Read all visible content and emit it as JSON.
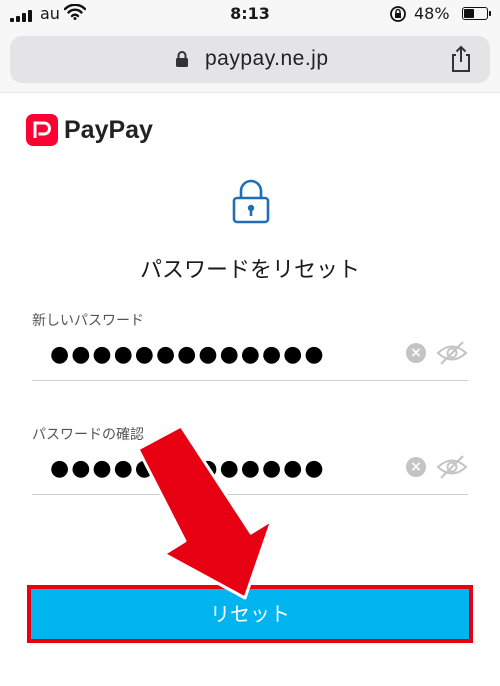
{
  "status_bar": {
    "carrier": "au",
    "time": "8:13",
    "battery_percent": "48%"
  },
  "browser": {
    "url": "paypay.ne.jp"
  },
  "brand": {
    "name": "PayPay",
    "color": "#ff0033"
  },
  "page": {
    "title": "パスワードをリセット"
  },
  "form": {
    "new_password": {
      "label": "新しいパスワード",
      "masked_value": "●●●●●●●●●●●●●"
    },
    "confirm_password": {
      "label": "パスワードの確認",
      "masked_value": "●●●●●●●●●●●●●"
    },
    "submit_label": "リセット"
  },
  "colors": {
    "button": "#00b4ef",
    "highlight": "#e60012",
    "icon_blue": "#1f6fb2"
  },
  "icons": [
    "signal-icon",
    "wifi-icon",
    "orientation-lock-icon",
    "battery-icon",
    "lock-icon",
    "share-icon",
    "paypay-logo-icon",
    "padlock-icon",
    "clear-icon",
    "eye-off-icon",
    "arrow-annotation"
  ]
}
